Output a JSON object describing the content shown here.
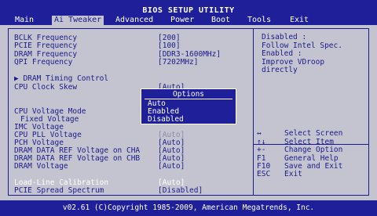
{
  "header": {
    "title": "BIOS SETUP UTILITY",
    "tabs": [
      "Main",
      "Ai Tweaker",
      "Advanced",
      "Power",
      "Boot",
      "Tools",
      "Exit"
    ]
  },
  "settings": [
    {
      "label": "BCLK Frequency",
      "value": "[200]"
    },
    {
      "label": "PCIE Frequency",
      "value": "[100]"
    },
    {
      "label": "DRAM Frequency",
      "value": "[DDR3-1600MHz]"
    },
    {
      "label": "QPI Frequency",
      "value": "[7202MHz]"
    },
    {
      "label": "▶ DRAM Timing Control",
      "value": ""
    },
    {
      "label": "CPU Clock Skew",
      "value": "[Auto]"
    },
    {
      "label": "CPU Voltage Mode",
      "value": ""
    },
    {
      "label": "Fixed Voltage",
      "value": ""
    },
    {
      "label": "IMC Voltage",
      "value": ""
    },
    {
      "label": "CPU PLL Voltage",
      "value": "[Auto]"
    },
    {
      "label": "PCH Voltage",
      "value": "[Auto]"
    },
    {
      "label": "DRAM DATA REF Voltage on CHA",
      "value": "[Auto]"
    },
    {
      "label": "DRAM DATA REF Voltage on CHB",
      "value": "[Auto]"
    },
    {
      "label": "DRAM Voltage",
      "value": "[Auto]"
    },
    {
      "label": "Load-Line Calibration",
      "value": "[Auto]"
    },
    {
      "label": "PCIE Spread Spectrum",
      "value": "[Disabled]"
    }
  ],
  "popup": {
    "title": "Options",
    "options": [
      "Auto",
      "Enabled",
      "Disabled"
    ]
  },
  "help": [
    "Disabled :",
    "Follow Intel Spec.",
    "Enabled :",
    "Improve VDroop",
    "directly"
  ],
  "keys": [
    {
      "key": "↔",
      "desc": "Select Screen"
    },
    {
      "key": "↑↓",
      "desc": "Select Item"
    },
    {
      "key": "+-",
      "desc": "Change Option"
    },
    {
      "key": "F1",
      "desc": "General Help"
    },
    {
      "key": "F10",
      "desc": "Save and Exit"
    },
    {
      "key": "ESC",
      "desc": "Exit"
    }
  ],
  "footer": {
    "copyright": "v02.61 (C)Copyright 1985-2009, American Megatrends, Inc."
  },
  "colors": {
    "header_bg": "#1f1f9a",
    "panel_bg": "#c4c4d0",
    "text": "#1a1a8a",
    "highlight_text": "#ffffff"
  }
}
